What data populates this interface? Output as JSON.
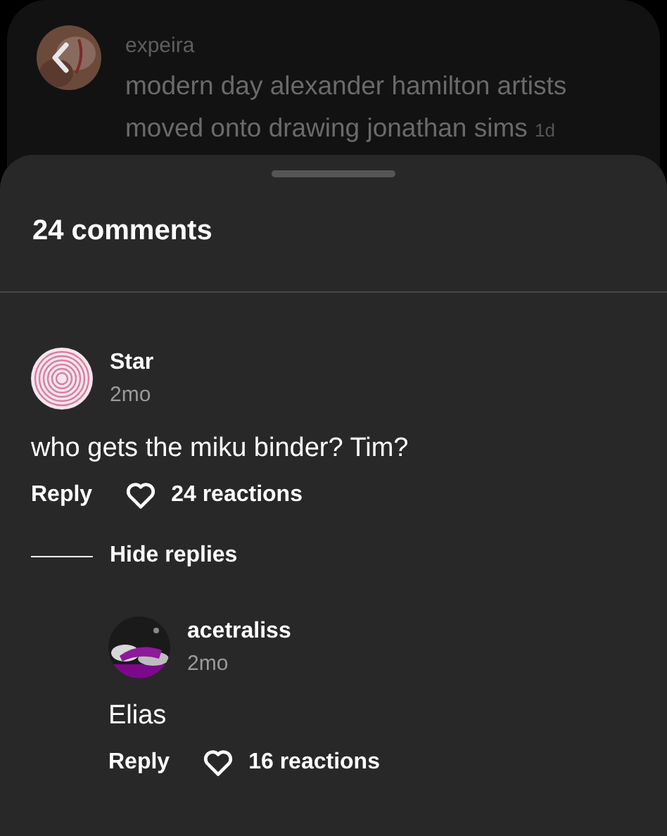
{
  "post": {
    "username": "expeira",
    "caption": "modern day alexander hamilton artists moved onto drawing jonathan sims",
    "time": "1d"
  },
  "sheet": {
    "title": "24 comments"
  },
  "comments": [
    {
      "username": "Star",
      "time": "2mo",
      "text": "who gets the miku binder? Tim?",
      "reply_label": "Reply",
      "reactions": "24 reactions",
      "liked": false,
      "hide_replies": "Hide replies",
      "replies": [
        {
          "username": "acetraliss",
          "time": "2mo",
          "text": "Elias",
          "reply_label": "Reply",
          "reactions": "16 reactions",
          "liked": false
        }
      ]
    }
  ]
}
